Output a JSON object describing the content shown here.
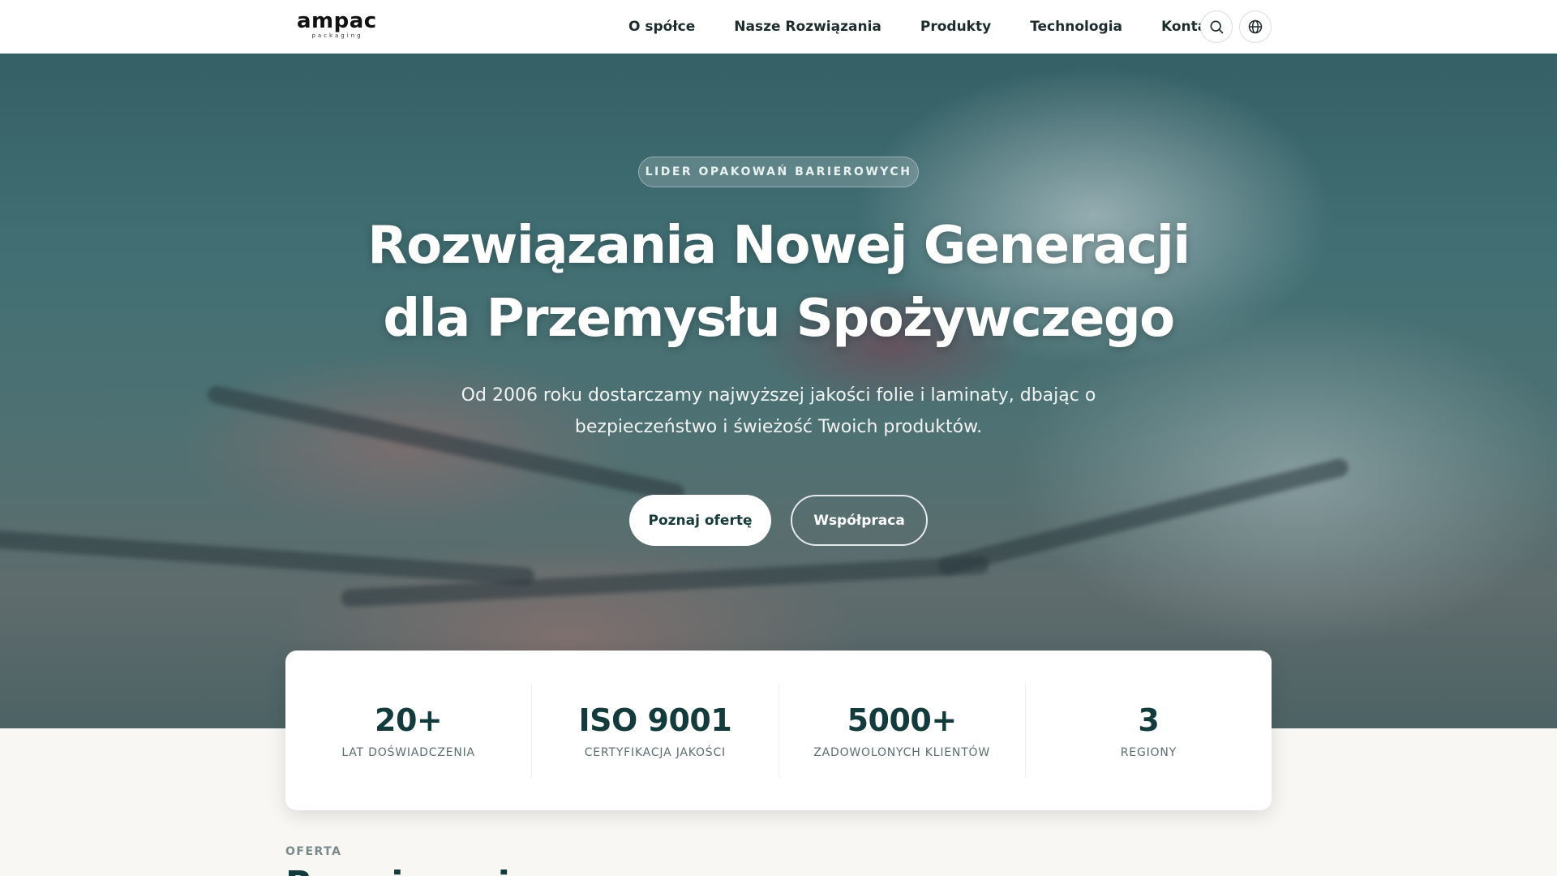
{
  "brand": {
    "name": "ampac",
    "tagline": "packaging"
  },
  "nav": {
    "items": [
      {
        "label": "O spółce"
      },
      {
        "label": "Nasze Rozwiązania"
      },
      {
        "label": "Produkty"
      },
      {
        "label": "Technologia"
      },
      {
        "label": "Kontakt"
      }
    ],
    "icons": [
      "search-icon",
      "globe-icon"
    ]
  },
  "hero": {
    "badge": "LIDER OPAKOWAŃ BARIEROWYCH",
    "title_line1": "Rozwiązania Nowej Generacji",
    "title_line2": "dla Przemysłu Spożywczego",
    "subtitle": "Od 2006 roku dostarczamy najwyższej jakości folie i laminaty, dbając o bezpieczeństwo i świeżość Twoich produktów.",
    "primary_button": "Poznaj ofertę",
    "secondary_button": "Współpraca"
  },
  "stats": [
    {
      "value": "20+",
      "label": "LAT DOŚWIADCZENIA"
    },
    {
      "value": "ISO 9001",
      "label": "CERTYFIKACJA JAKOŚCI"
    },
    {
      "value": "5000+",
      "label": "ZADOWOLONYCH KLIENTÓW"
    },
    {
      "value": "3",
      "label": "REGIONY"
    }
  ],
  "offer": {
    "eyebrow": "OFERTA",
    "title": "Rozwiązania"
  },
  "colors": {
    "accent": "#143b3b",
    "nav_bg": "#ffffff",
    "page_bg": "#f8f7f4"
  }
}
